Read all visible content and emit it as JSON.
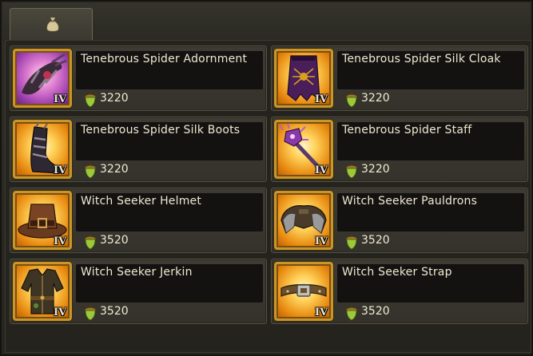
{
  "tabs": [
    {
      "icon": "money-bag-icon"
    }
  ],
  "currency_icon": "acorn-icon",
  "items": [
    {
      "name": "Tenebrous Spider Adornment",
      "tier": "IV",
      "price": "3220",
      "icon": "spider-adornment-icon"
    },
    {
      "name": "Tenebrous Spider Silk Cloak",
      "tier": "IV",
      "price": "3220",
      "icon": "spider-cloak-icon"
    },
    {
      "name": "Tenebrous Spider Silk Boots",
      "tier": "IV",
      "price": "3220",
      "icon": "spider-boots-icon"
    },
    {
      "name": "Tenebrous Spider Staff",
      "tier": "IV",
      "price": "3220",
      "icon": "spider-staff-icon"
    },
    {
      "name": "Witch Seeker Helmet",
      "tier": "IV",
      "price": "3520",
      "icon": "witch-hat-icon"
    },
    {
      "name": "Witch Seeker Pauldrons",
      "tier": "IV",
      "price": "3520",
      "icon": "pauldrons-icon"
    },
    {
      "name": "Witch Seeker Jerkin",
      "tier": "IV",
      "price": "3520",
      "icon": "jerkin-icon"
    },
    {
      "name": "Witch Seeker Strap",
      "tier": "IV",
      "price": "3520",
      "icon": "strap-belt-icon"
    }
  ]
}
